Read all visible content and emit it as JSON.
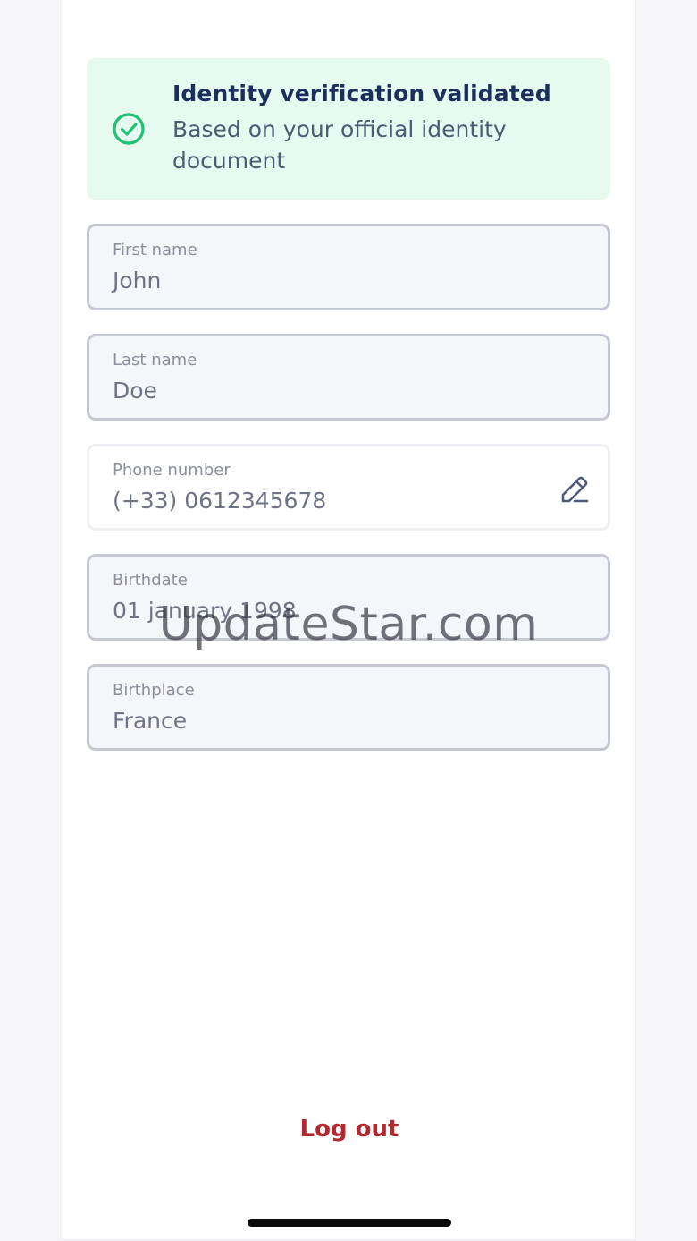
{
  "banner": {
    "icon": "check-circle-icon",
    "title": "Identity verification validated",
    "subtitle": "Based on your official identity document"
  },
  "fields": {
    "first_name": {
      "label": "First name",
      "value": "John"
    },
    "last_name": {
      "label": "Last name",
      "value": "Doe"
    },
    "phone": {
      "label": "Phone number",
      "value": "(+33) 0612345678",
      "icon": "pencil-edit-icon"
    },
    "birthdate": {
      "label": "Birthdate",
      "value": "01 january 1998"
    },
    "birthplace": {
      "label": "Birthplace",
      "value": "France"
    }
  },
  "actions": {
    "logout_label": "Log out"
  },
  "watermark": "UpdateStar.com",
  "colors": {
    "banner_bg": "#e6faf0",
    "success": "#1dc274",
    "title": "#1a2f5c",
    "logout": "#b3282d"
  }
}
